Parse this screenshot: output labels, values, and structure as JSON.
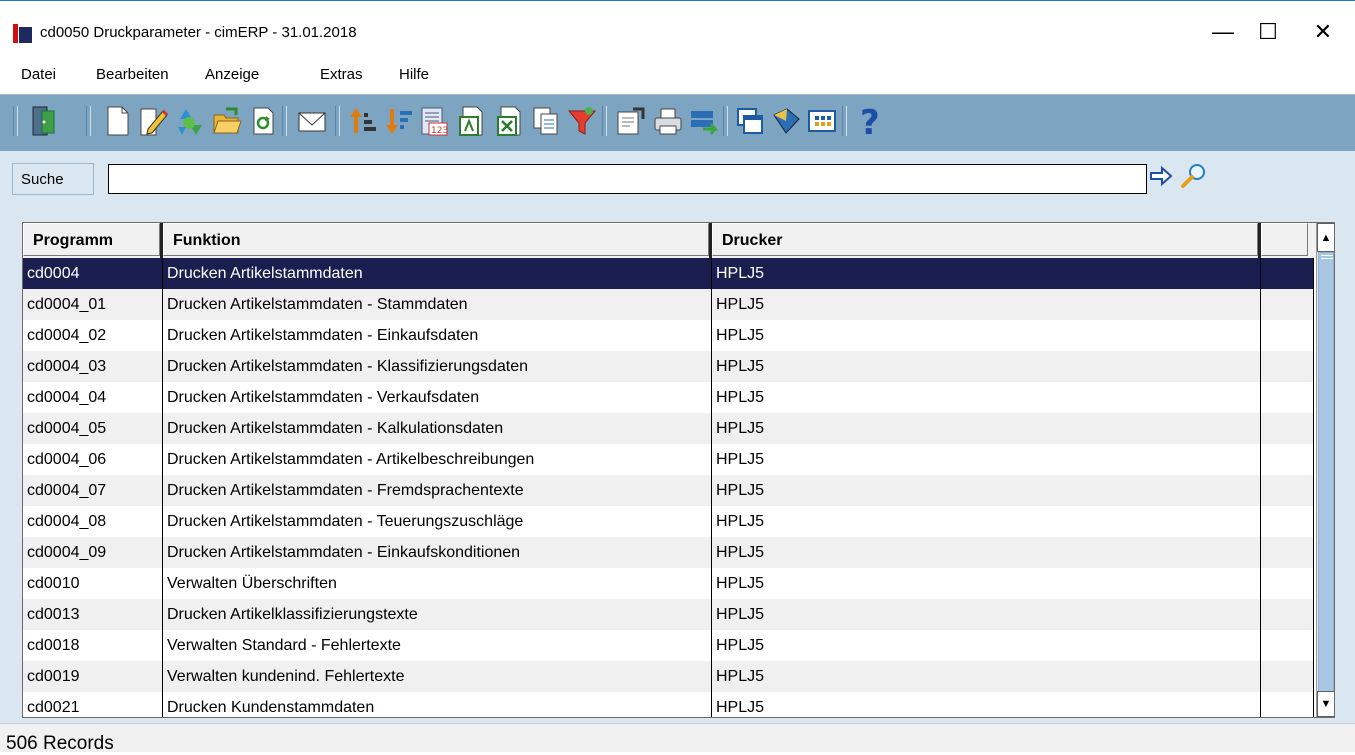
{
  "window": {
    "title": "cd0050 Druckparameter - cimERP - 31.01.2018",
    "minimize": "—",
    "maximize": "☐",
    "close": "✕"
  },
  "menu": {
    "items": [
      "Datei",
      "Bearbeiten",
      "Anzeige",
      "Extras",
      "Hilfe"
    ]
  },
  "toolbar": {
    "icons": [
      "exit-door",
      "new-document",
      "edit-pencil",
      "recycle",
      "open-folder",
      "refresh",
      "envelope",
      "sort-ascending",
      "sort-descending",
      "numbered-list",
      "export-pdf",
      "export-excel",
      "copy",
      "filter",
      "properties",
      "printer",
      "transfer",
      "windows",
      "label",
      "table-view",
      "help"
    ]
  },
  "search": {
    "label": "Suche",
    "value": ""
  },
  "table": {
    "columns": [
      "Programm",
      "Funktion",
      "Drucker",
      ""
    ],
    "rows": [
      [
        "cd0004",
        "Drucken Artikelstammdaten",
        "HPLJ5"
      ],
      [
        "cd0004_01",
        "Drucken Artikelstammdaten - Stammdaten",
        "HPLJ5"
      ],
      [
        "cd0004_02",
        "Drucken Artikelstammdaten - Einkaufsdaten",
        "HPLJ5"
      ],
      [
        "cd0004_03",
        "Drucken Artikelstammdaten - Klassifizierungsdaten",
        "HPLJ5"
      ],
      [
        "cd0004_04",
        "Drucken Artikelstammdaten - Verkaufsdaten",
        "HPLJ5"
      ],
      [
        "cd0004_05",
        "Drucken Artikelstammdaten - Kalkulationsdaten",
        "HPLJ5"
      ],
      [
        "cd0004_06",
        "Drucken Artikelstammdaten - Artikelbeschreibungen",
        "HPLJ5"
      ],
      [
        "cd0004_07",
        "Drucken Artikelstammdaten - Fremdsprachentexte",
        "HPLJ5"
      ],
      [
        "cd0004_08",
        "Drucken Artikelstammdaten - Teuerungszuschläge",
        "HPLJ5"
      ],
      [
        "cd0004_09",
        "Drucken Artikelstammdaten - Einkaufskonditionen",
        "HPLJ5"
      ],
      [
        "cd0010",
        "Verwalten Überschriften",
        "HPLJ5"
      ],
      [
        "cd0013",
        "Drucken Artikelklassifizierungstexte",
        "HPLJ5"
      ],
      [
        "cd0018",
        "Verwalten Standard - Fehlertexte",
        "HPLJ5"
      ],
      [
        "cd0019",
        "Verwalten kundenind. Fehlertexte",
        "HPLJ5"
      ],
      [
        "cd0021",
        "Drucken Kundenstammdaten",
        "HPLJ5"
      ]
    ],
    "selected_row": 0
  },
  "status": {
    "text": "506 Records"
  },
  "colors": {
    "toolbar_bg": "#7da5c2",
    "panel_bg": "#dbe7f0",
    "selected_row": "#1a1f4f"
  }
}
